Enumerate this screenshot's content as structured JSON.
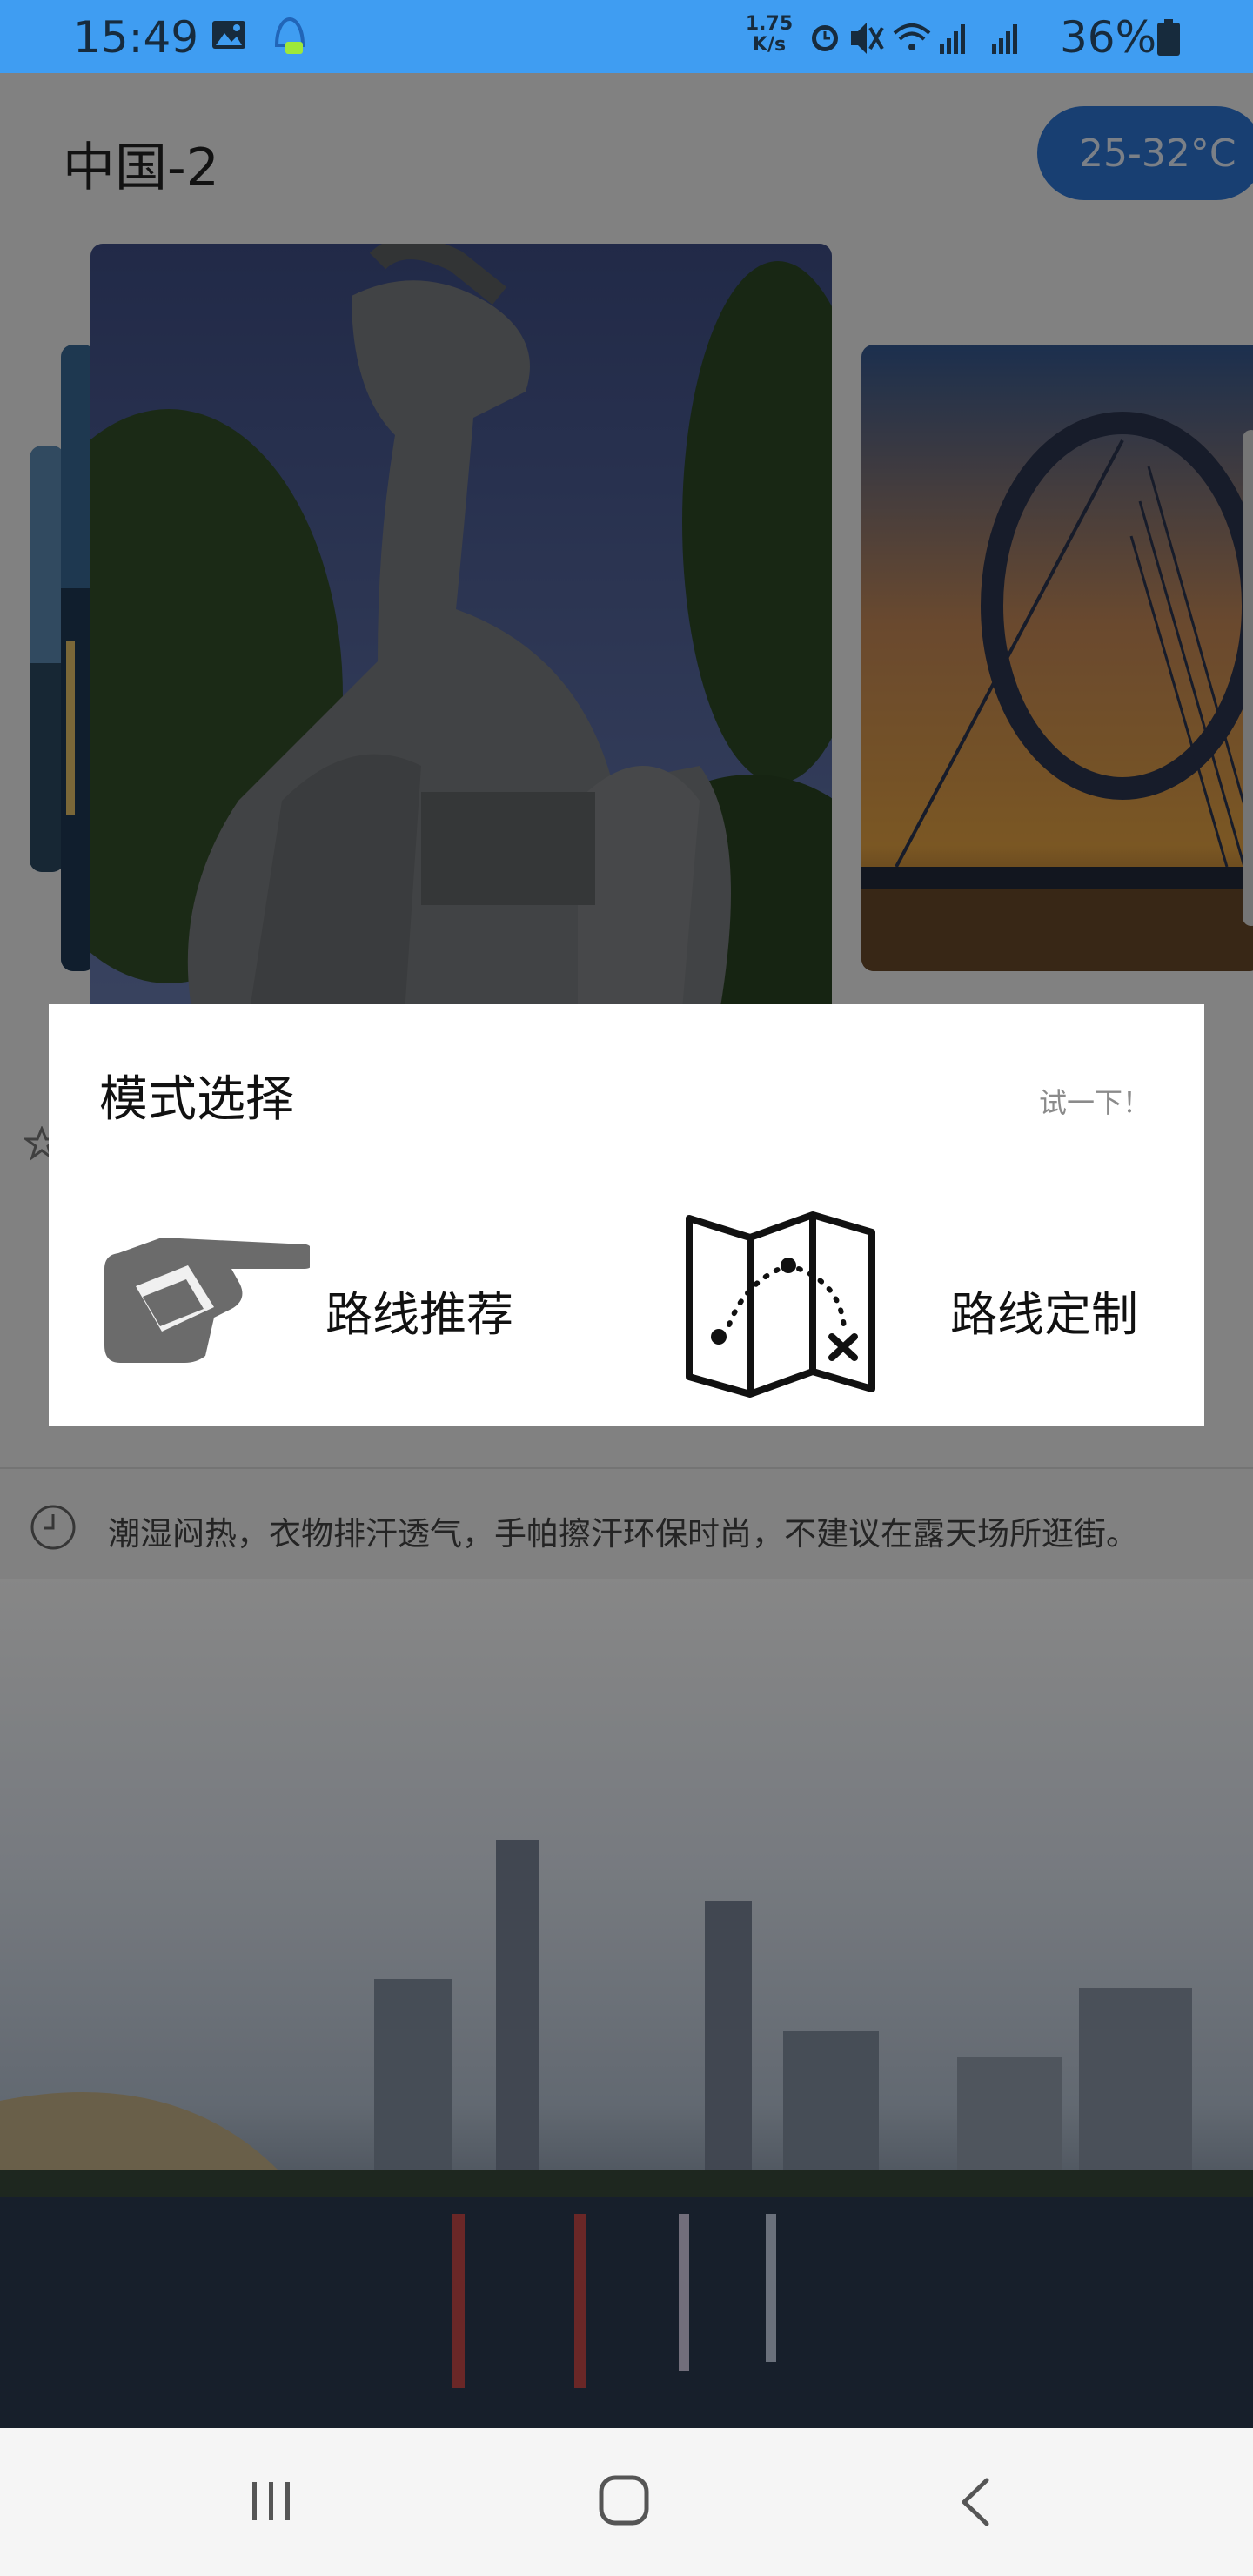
{
  "status_bar": {
    "time": "15:49",
    "net_speed_value": "1.75",
    "net_speed_unit": "K/s",
    "battery": "36%",
    "icons": [
      "gallery-icon",
      "assistant-bell-icon",
      "alarm-icon",
      "mute-icon",
      "wifi-icon",
      "signal-e-icon",
      "signal-4g-icon",
      "battery-icon"
    ]
  },
  "header": {
    "title": "中国-2",
    "temperature": "25-32°C"
  },
  "carousel": {
    "cards": [
      "five-goats-statue-photo",
      "ring-bridge-sunset-photo",
      "city-night-photo-left"
    ]
  },
  "tip": {
    "text": "潮湿闷热，衣物排汗透气，手帕擦汗环保时尚，不建议在露天场所逛街。"
  },
  "dialog": {
    "title": "模式选择",
    "hint": "试一下！",
    "options": [
      {
        "label": "路线推荐",
        "icon": "pointing-hand-icon"
      },
      {
        "label": "路线定制",
        "icon": "map-route-icon"
      }
    ]
  },
  "colors": {
    "status_bar": "#3f9df2",
    "temp_pill": "#2f78d7",
    "overlay": "rgba(0,0,0,0.47)",
    "dialog_bg": "#ffffff"
  },
  "nav_bar": {
    "buttons": [
      "recent-apps-icon",
      "home-icon",
      "back-icon"
    ]
  }
}
